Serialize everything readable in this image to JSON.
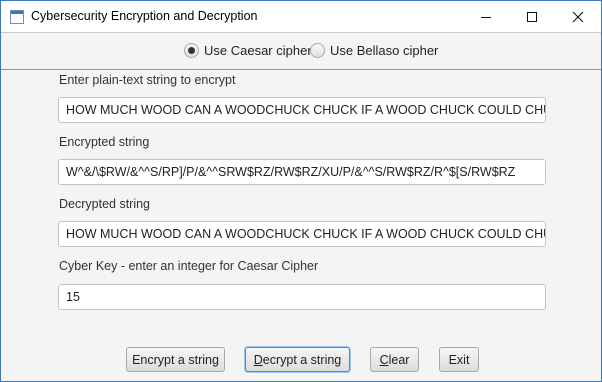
{
  "window": {
    "title": "Cybersecurity Encryption and Decryption",
    "controls": {
      "minimize": "minimize-icon",
      "maximize": "maximize-icon",
      "close": "close-icon"
    }
  },
  "cipher_options": [
    {
      "label": "Use Caesar cipher",
      "selected": true
    },
    {
      "label": "Use Bellaso cipher",
      "selected": false
    }
  ],
  "fields": {
    "plain": {
      "label": "Enter plain-text string to encrypt",
      "value": "HOW MUCH WOOD CAN A WOODCHUCK CHUCK IF A WOOD CHUCK COULD CHUCK"
    },
    "encrypted": {
      "label": "Encrypted string",
      "value": "W^&/\\$RW/&^^S/RP]/P/&^^SRW$RZ/RW$RZ/XU/P/&^^S/RW$RZ/R^$[S/RW$RZ"
    },
    "decrypted": {
      "label": "Decrypted string",
      "value": "HOW MUCH WOOD CAN A WOODCHUCK CHUCK IF A WOOD CHUCK COULD CHUCK"
    },
    "key": {
      "label": "Cyber Key - enter an integer for Caesar Cipher",
      "value": "15"
    }
  },
  "buttons": {
    "encrypt": {
      "mnemonic": "",
      "rest": "Encrypt a string"
    },
    "decrypt": {
      "mnemonic": "D",
      "rest": "ecrypt a string"
    },
    "clear": {
      "mnemonic": "C",
      "rest": "lear"
    },
    "exit": {
      "mnemonic": "",
      "rest": "Exit"
    }
  },
  "colors": {
    "accent": "#3c8ee0",
    "window_border": "#3c78b5"
  }
}
